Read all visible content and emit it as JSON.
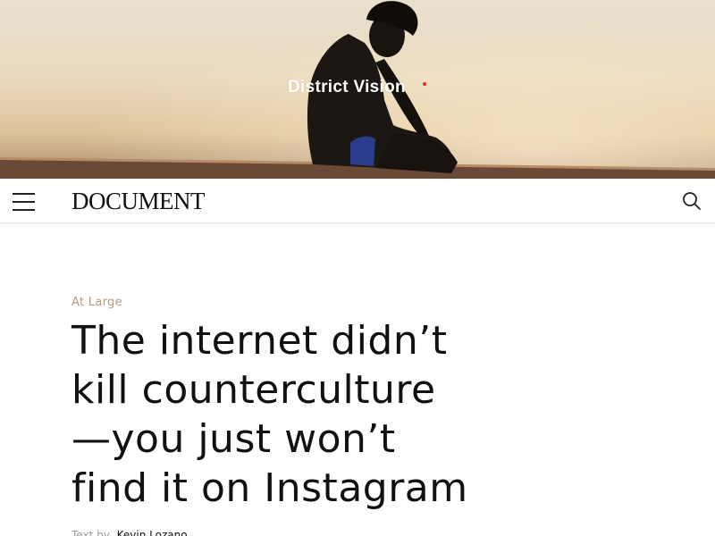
{
  "ad": {
    "brand": "District Vision"
  },
  "nav": {
    "logo": "DOCUMENT",
    "menu_icon": "hamburger-menu-icon",
    "search_icon": "search-icon"
  },
  "article": {
    "kicker": "At Large",
    "headline_lines": [
      "The internet didn’t",
      "kill counterculture",
      "—you just won’t",
      "find it on Instagram"
    ],
    "byline_prefix": "Text by",
    "byline_author": "Kevin Lozano"
  },
  "colors": {
    "kicker": "#b49a7e",
    "text": "#111111",
    "brand_dot": "#d8342b"
  }
}
